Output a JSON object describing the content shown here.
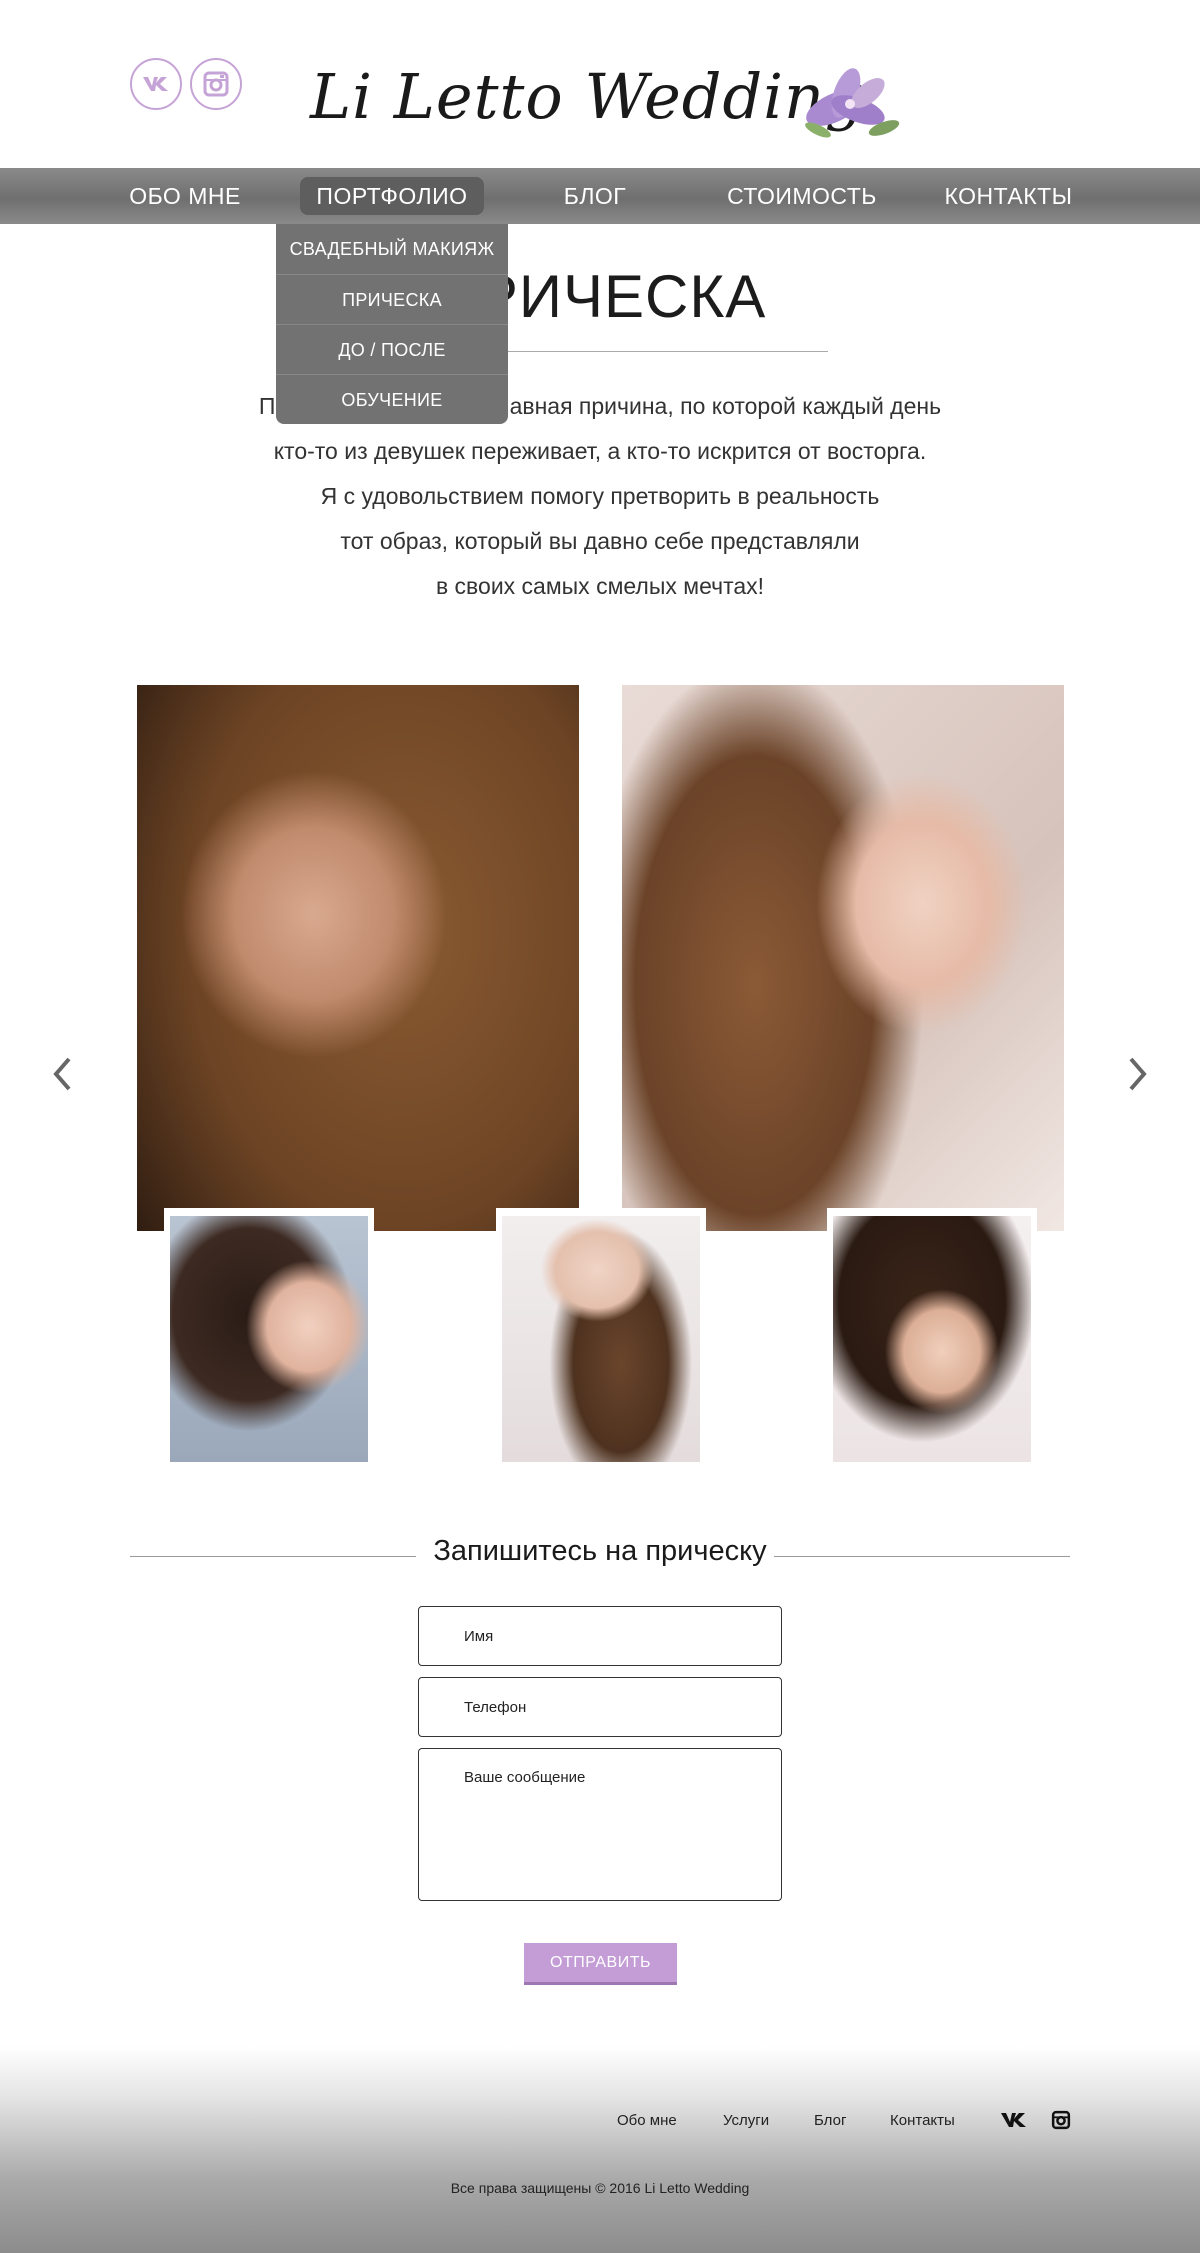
{
  "header": {
    "logo_text": "Li Letto Wedding",
    "social": [
      {
        "name": "vk-icon",
        "label": "VK"
      },
      {
        "name": "instagram-icon",
        "label": "Instagram"
      }
    ]
  },
  "nav": {
    "items": [
      {
        "label": "ОБО МНЕ",
        "active": false
      },
      {
        "label": "ПОРТФОЛИО",
        "active": true
      },
      {
        "label": "БЛОГ",
        "active": false
      },
      {
        "label": "СТОИМОСТЬ",
        "active": false
      },
      {
        "label": "КОНТАКТЫ",
        "active": false
      }
    ],
    "dropdown": [
      {
        "label": "СВАДЕБНЫЙ МАКИЯЖ"
      },
      {
        "label": "ПРИЧЕСКА"
      },
      {
        "label": "ДО / ПОСЛЕ"
      },
      {
        "label": "ОБУЧЕНИЕ"
      }
    ]
  },
  "page": {
    "title": "ПРИЧЕСКА",
    "intro": [
      "Пышная прическа — главная причина, по которой каждый день",
      "кто-то из девушек переживает, а кто-то искрится от восторга.",
      "Я с удовольствием помогу претворить в реальность",
      "тот образ, который вы давно себе представляли",
      "в своих самых смелых мечтах!"
    ]
  },
  "gallery": {
    "prev_icon": "chevron-left-icon",
    "next_icon": "chevron-right-icon"
  },
  "form": {
    "title": "Запишитесь на прическу",
    "name_placeholder": "Имя",
    "phone_placeholder": "Телефон",
    "message_placeholder": "Ваше сообщение",
    "submit_label": "ОТПРАВИТЬ"
  },
  "footer": {
    "links": [
      {
        "label": "Обо мне"
      },
      {
        "label": "Услуги"
      },
      {
        "label": "Блог"
      },
      {
        "label": "Контакты"
      }
    ],
    "copyright": "Все права защищены © 2016 Li Letto Wedding"
  },
  "colors": {
    "accent": "#c49cd6",
    "nav_bg": "#7a7a7a",
    "dropdown_bg": "#727272"
  }
}
